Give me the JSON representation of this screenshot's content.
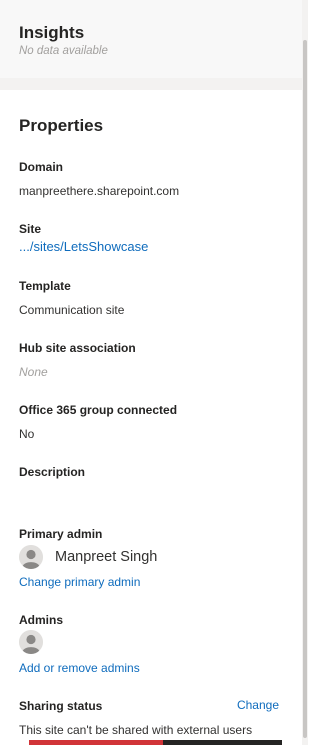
{
  "insights": {
    "title": "Insights",
    "subtitle": "No data available"
  },
  "properties": {
    "title": "Properties",
    "domain": {
      "label": "Domain",
      "value": "manpreethere.sharepoint.com"
    },
    "site": {
      "label": "Site",
      "value": ".../sites/LetsShowcase"
    },
    "template": {
      "label": "Template",
      "value": "Communication site"
    },
    "hub": {
      "label": "Hub site association",
      "value": "None"
    },
    "group": {
      "label": "Office 365 group connected",
      "value": "No"
    },
    "description": {
      "label": "Description"
    },
    "primary_admin": {
      "label": "Primary admin",
      "name": "Manpreet Singh",
      "change_link": "Change primary admin"
    },
    "admins": {
      "label": "Admins",
      "link": "Add or remove admins"
    },
    "sharing": {
      "label": "Sharing status",
      "change": "Change",
      "value": "This site can't be shared with external users"
    }
  },
  "progress": {
    "fraction": 0.53
  },
  "colors": {
    "link": "#0f6cbd",
    "progress_fill": "#d13438",
    "progress_track": "#252423",
    "insights_bg": "#f8f8f8",
    "band_bg": "#f3f2f1"
  },
  "icons": {
    "avatar": "person-avatar-icon"
  }
}
